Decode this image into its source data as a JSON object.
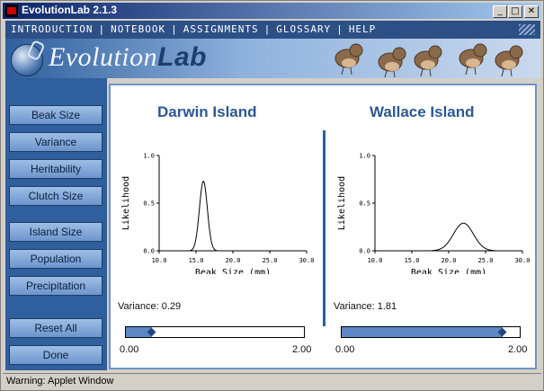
{
  "window": {
    "title": "EvolutionLab 2.1.3",
    "minimize_icon": "minimize-icon",
    "maximize_icon": "maximize-icon",
    "close_icon": "close-icon",
    "min_glyph": "_",
    "max_glyph": "□",
    "close_glyph": "✕"
  },
  "menu": {
    "items": [
      "INTRODUCTION",
      "NOTEBOOK",
      "ASSIGNMENTS",
      "GLOSSARY",
      "HELP"
    ],
    "separator": "|"
  },
  "banner": {
    "logo_light": "Evolution",
    "logo_bold": "Lab"
  },
  "sidebar": {
    "buttons": [
      "Beak Size",
      "Variance",
      "Heritability",
      "Clutch Size",
      "Island Size",
      "Population",
      "Precipitation"
    ],
    "reset_label": "Reset All",
    "done_label": "Done"
  },
  "islands": [
    {
      "name": "Darwin Island",
      "variance_text": "Variance: 0.29",
      "slider": {
        "min_label": "0.00",
        "max_label": "2.00",
        "value": 0.29,
        "min": 0,
        "max": 2
      }
    },
    {
      "name": "Wallace Island",
      "variance_text": "Variance: 1.81",
      "slider": {
        "min_label": "0.00",
        "max_label": "2.00",
        "value": 1.81,
        "min": 0,
        "max": 2
      }
    }
  ],
  "chart_data": [
    {
      "type": "line",
      "xlabel": "Beak Size (mm)",
      "ylabel": "Likelihood",
      "xlim": [
        10,
        30
      ],
      "ylim": [
        0,
        1
      ],
      "xticks": [
        "10.0",
        "15.0",
        "20.0",
        "25.0",
        "30.0"
      ],
      "yticks": [
        "0.0",
        "0.5",
        "1.0"
      ],
      "curve": {
        "kind": "normal",
        "mean": 16.0,
        "sd": 0.54,
        "peak": 0.73
      }
    },
    {
      "type": "line",
      "xlabel": "Beak Size (mm)",
      "ylabel": "Likelihood",
      "xlim": [
        10,
        30
      ],
      "ylim": [
        0,
        1
      ],
      "xticks": [
        "10.0",
        "15.0",
        "20.0",
        "25.0",
        "30.0"
      ],
      "yticks": [
        "0.0",
        "0.5",
        "1.0"
      ],
      "curve": {
        "kind": "normal",
        "mean": 22.0,
        "sd": 1.35,
        "peak": 0.29
      }
    }
  ],
  "status": {
    "text": "Warning: Applet Window"
  }
}
